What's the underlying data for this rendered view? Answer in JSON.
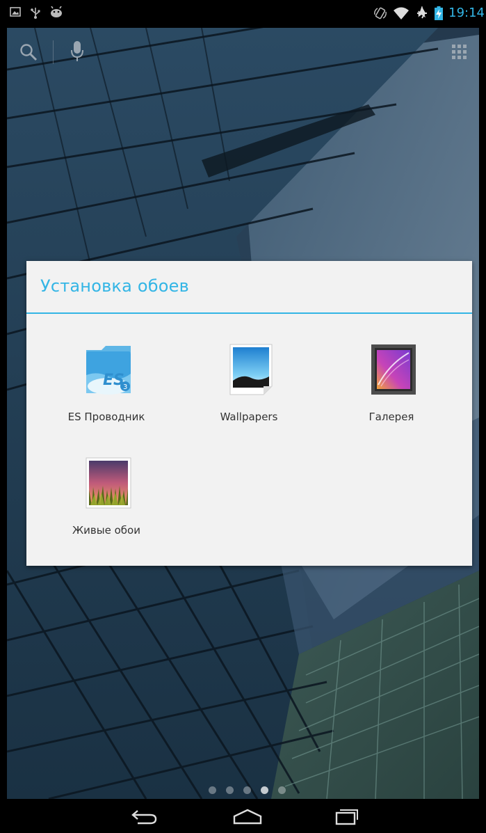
{
  "status_bar": {
    "time": "19:14",
    "left_icons": [
      "picture-notification-icon",
      "usb-icon",
      "android-debug-icon"
    ],
    "right_icons": [
      "rotation-lock-icon",
      "wifi-icon",
      "airplane-mode-icon",
      "battery-charging-icon"
    ]
  },
  "launcher": {
    "icons": [
      "search-icon",
      "microphone-icon",
      "all-apps-icon"
    ]
  },
  "dialog": {
    "title": "Установка обоев",
    "apps": [
      {
        "label": "ES Проводник",
        "icon": "es-file-explorer-icon"
      },
      {
        "label": "Wallpapers",
        "icon": "wallpapers-icon"
      },
      {
        "label": "Галерея",
        "icon": "gallery-icon"
      },
      {
        "label": "Живые обои",
        "icon": "live-wallpapers-icon"
      }
    ]
  },
  "page_indicator": {
    "total": 5,
    "current": 4
  },
  "nav_bar": {
    "buttons": [
      "back-icon",
      "home-icon",
      "recent-apps-icon"
    ]
  },
  "colors": {
    "accent": "#33b5e5",
    "dialog_bg": "#f2f2f2",
    "label_text": "#333333"
  }
}
